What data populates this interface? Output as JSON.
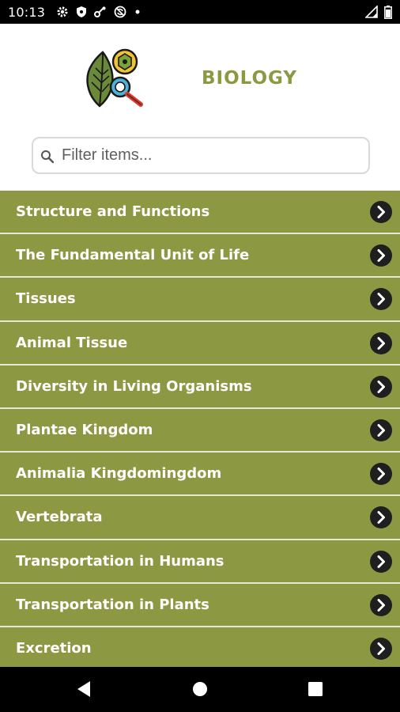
{
  "status_bar": {
    "time": "10:13",
    "icons": [
      "gear-icon",
      "shield-icon",
      "key-icon",
      "no-sync-icon",
      "dot-icon"
    ],
    "right_icons": [
      "cell-signal-icon",
      "battery-icon"
    ]
  },
  "header": {
    "title": "BIOLOGY",
    "logo": "leaf-magnifier-logo"
  },
  "search": {
    "placeholder": "Filter items...",
    "value": ""
  },
  "list": {
    "items": [
      {
        "label": "Structure and Functions"
      },
      {
        "label": "The Fundamental Unit of Life"
      },
      {
        "label": "Tissues"
      },
      {
        "label": "Animal Tissue"
      },
      {
        "label": "Diversity in Living Organisms"
      },
      {
        "label": "Plantae Kingdom"
      },
      {
        "label": "Animalia Kingdomingdom"
      },
      {
        "label": "Vertebrata"
      },
      {
        "label": "Transportation in Humans"
      },
      {
        "label": "Transportation in Plants"
      },
      {
        "label": "Excretion"
      }
    ]
  },
  "colors": {
    "accent": "#8d9842",
    "list_divider": "#e6e8d2",
    "chevron_bg": "#1f1f1f"
  },
  "nav_bar": {
    "buttons": [
      "back-icon",
      "home-icon",
      "recents-icon"
    ]
  }
}
